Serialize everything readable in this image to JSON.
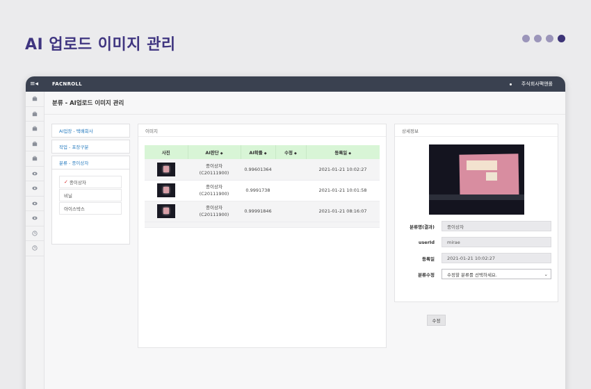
{
  "page": {
    "title": "AI 업로드 이미지 관리"
  },
  "topbar": {
    "brand": "FACNROLL",
    "company": "주식회사팩앤롤"
  },
  "header": {
    "breadcrumb": "분류 - AI업로드 이미지 관리"
  },
  "left_menu": {
    "groups": [
      "AI업장 - 택배회사",
      "작업 - 포장구분",
      "분류 - 종이상자"
    ],
    "options": [
      "종이상자",
      "비닐",
      "아이스박스"
    ],
    "selected_option": "종이상자"
  },
  "image_panel": {
    "title": "이미지",
    "columns": [
      "사진",
      "AI판단",
      "AI확률",
      "수정",
      "등록일"
    ],
    "rows": [
      {
        "ai_label": "종이상자",
        "ai_code": "(C20111900)",
        "prob": "0.99601364",
        "edit": "",
        "date": "2021-01-21 10:02:27"
      },
      {
        "ai_label": "종이상자",
        "ai_code": "(C20111900)",
        "prob": "0.9991738",
        "edit": "",
        "date": "2021-01-21 10:01:58"
      },
      {
        "ai_label": "종이상자",
        "ai_code": "(C20111900)",
        "prob": "0.99991846",
        "edit": "",
        "date": "2021-01-21 08:16:07"
      }
    ]
  },
  "detail_panel": {
    "title": "상세정보",
    "fields": {
      "class_label": "분류명(결과)",
      "class_value": "종이상자",
      "user_label": "userId",
      "user_value": "mirae",
      "date_label": "등록일",
      "date_value": "2021-01-21 10:02:27",
      "edit_label": "분류수정",
      "edit_placeholder": "수정할 분류를 선택하세요."
    },
    "edit_button": "수정"
  },
  "colors": {
    "title": "#3f3580",
    "topbar": "#3a4150",
    "table_header": "#d8f5d6",
    "link": "#2a7dc0"
  }
}
